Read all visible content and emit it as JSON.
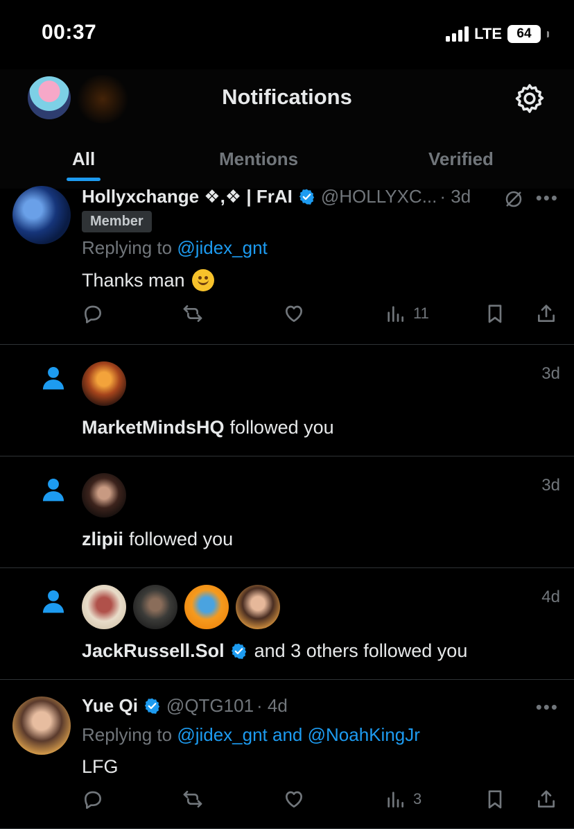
{
  "status_bar": {
    "time": "00:37",
    "network": "LTE",
    "battery": "64"
  },
  "header": {
    "title": "Notifications"
  },
  "tabs": [
    {
      "label": "All",
      "active": true
    },
    {
      "label": "Mentions",
      "active": false
    },
    {
      "label": "Verified",
      "active": false
    }
  ],
  "notifications": [
    {
      "type": "reply",
      "name": "Hollyxchange ❖,❖ | FrAI",
      "handle": "@HOLLYXC...",
      "time": "· 3d",
      "badge": "Member",
      "replying_prefix": "Replying to ",
      "replying_to": "@jidex_gnt",
      "text": "Thanks man",
      "views": "11"
    },
    {
      "type": "follow",
      "time": "3d",
      "name": "MarketMindsHQ",
      "text": "followed you"
    },
    {
      "type": "follow",
      "time": "3d",
      "name": "zlipii",
      "text": "followed you"
    },
    {
      "type": "follow",
      "time": "4d",
      "name": "JackRussell.Sol",
      "text": "and 3 others followed you"
    },
    {
      "type": "reply",
      "name": "Yue Qi",
      "handle": "@QTG101",
      "time": "· 4d",
      "replying_prefix": "Replying to ",
      "replying_to": "@jidex_gnt and @NoahKingJr",
      "text": "LFG",
      "views": "3"
    }
  ],
  "icons": {
    "reply": "speech-bubble-icon",
    "retweet": "retweet-icon",
    "like": "heart-icon",
    "views": "bar-chart-icon",
    "bookmark": "bookmark-icon",
    "share": "share-icon",
    "settings": "gear-icon",
    "follow": "person-icon",
    "verified": "verified-badge-icon",
    "mute": "mute-icon"
  },
  "colors": {
    "accent": "#1d9bf0",
    "background": "#000000",
    "muted": "#71767b",
    "text": "#e7e9ea"
  }
}
